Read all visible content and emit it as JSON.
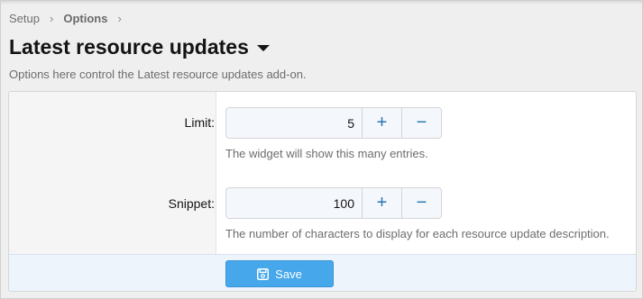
{
  "breadcrumb": {
    "items": [
      {
        "label": "Setup"
      },
      {
        "label": "Options"
      }
    ],
    "separator": "›"
  },
  "header": {
    "title": "Latest resource updates",
    "description": "Options here control the Latest resource updates add-on."
  },
  "options": {
    "limit": {
      "label": "Limit:",
      "value": "5",
      "increment": "+",
      "decrement": "−",
      "hint": "The widget will show this many entries."
    },
    "snippet": {
      "label": "Snippet:",
      "value": "100",
      "increment": "+",
      "decrement": "−",
      "hint": "The number of characters to display for each resource update description."
    }
  },
  "actions": {
    "save_label": "Save"
  },
  "colors": {
    "accent": "#47a7eb",
    "stepper_button": "#2577b1",
    "submit_row": "#edf4fc"
  },
  "icons": {
    "title_menu": "caret-down-icon",
    "save": "floppy-disk-icon"
  }
}
